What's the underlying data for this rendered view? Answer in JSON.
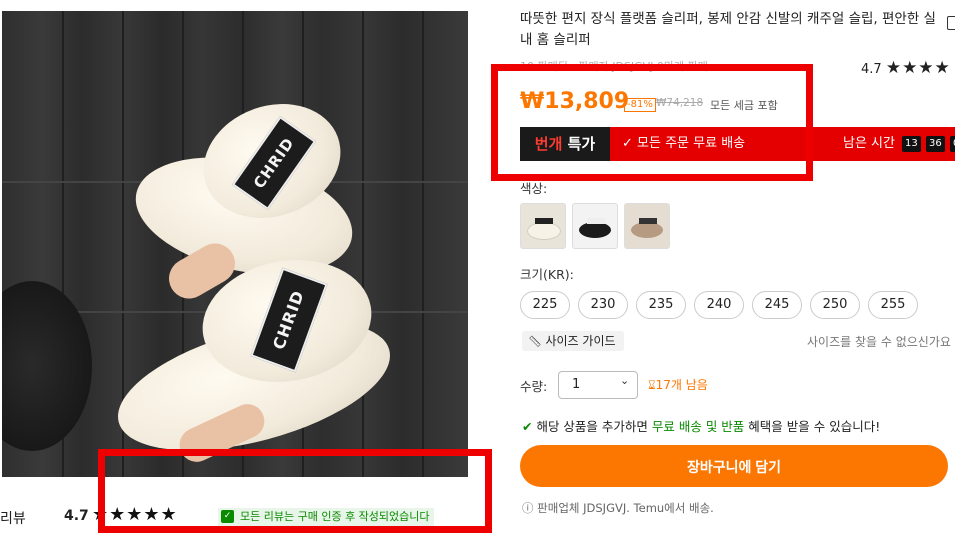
{
  "product": {
    "title": "따뜻한 편지 장식 플랫폼 슬리퍼, 봉제 안감 신발의 캐주얼 슬립, 편안한 실내 홈 슬리퍼",
    "seller_line": "10 판매됨 · 판매자 JDSJGVJ 0만개 판매",
    "rating": "4.7",
    "stars": "★★★★",
    "image_strap_text": "CHRID"
  },
  "price": {
    "current": "₩13,809",
    "discount": "-81%",
    "original": "₩74,218",
    "tax_note": "모든 세금 포함"
  },
  "flash": {
    "label_highlight": "번개",
    "label_rest": " 특가",
    "free_shipping": "모든 주문 무료 배송",
    "timer_label": "남은 시간",
    "timer": [
      "13",
      "36",
      "0"
    ]
  },
  "options": {
    "color_label": "색상:",
    "size_label": "크기(KR):",
    "sizes": [
      "225",
      "230",
      "235",
      "240",
      "245",
      "250",
      "255"
    ],
    "size_guide": "사이즈 가이드",
    "size_help": "사이즈를 찾을 수 없으신가요",
    "qty_label": "수량:",
    "qty_value": "1",
    "stock_left": "17개 남음"
  },
  "benefit": {
    "prefix": "해당 상품을 추가하면 ",
    "free_ship": "무료 배송 및 반품",
    "suffix": " 혜택을 받을 수 있습니다!"
  },
  "cart": {
    "button": "장바구니에 담기"
  },
  "seller_note": "판매업체 JDSJGVJ. Temu에서 배송.",
  "reviews": {
    "label": "리뷰",
    "rating": "4.7",
    "stars": "★★★★★",
    "verified": "모든 리뷰는 구매 인증 후 작성되었습니다"
  },
  "colors": {
    "accent": "#fb7701",
    "flash_red": "#e40000",
    "annotation_red": "#ee0000",
    "green": "#0a8a00"
  }
}
